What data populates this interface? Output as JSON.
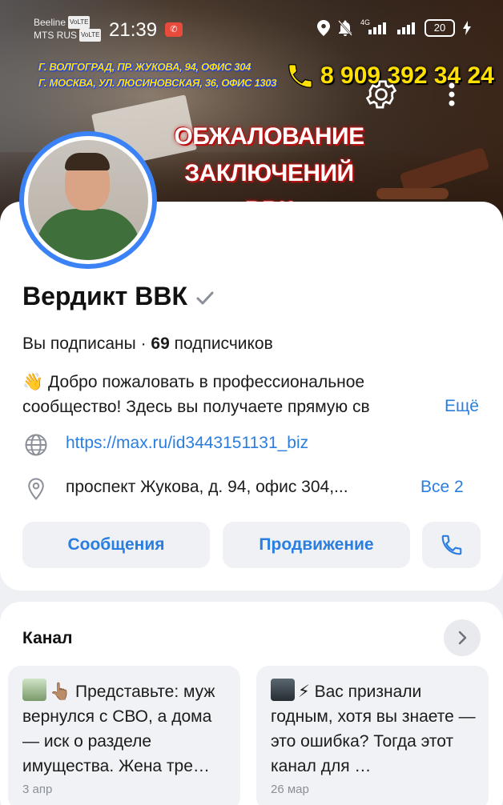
{
  "status_bar": {
    "carrier1": "Beeline",
    "carrier2": "MTS RUS",
    "volte": "VoLTE",
    "time": "21:39",
    "network": "4G",
    "battery": "20"
  },
  "cover": {
    "address_line1": "Г. ВОЛГОГРАД, ПР. ЖУКОВА, 94, ОФИС 304",
    "address_line2": "Г. МОСКВА, УЛ. ЛЮСИНОВСКАЯ, 36, ОФИС 1303",
    "phone": "8 909 392 34 24",
    "title_line1": "ОБЖАЛОВАНИЕ",
    "title_line2": "ЗАКЛЮЧЕНИЙ ВВК",
    "title_color": "#c01010",
    "accent_yellow": "#ffe000"
  },
  "profile": {
    "name": "Вердикт ВВК",
    "subscribed_prefix": "Вы подписаны · ",
    "subscribers_count": "69",
    "subscribers_suffix": " подписчиков",
    "description": "👋 Добро пожаловать в профессиональное сообщество! Здесь вы получаете прямую св",
    "more_label": "Ещё",
    "link": "https://max.ru/id3443151131_biz",
    "address": "проспект Жукова, д. 94, офис 304,...",
    "all_addresses_label": "Все 2",
    "accent": "#2a7ee0"
  },
  "buttons": {
    "messages": "Сообщения",
    "promotion": "Продвижение"
  },
  "channel": {
    "title": "Канал",
    "posts": [
      {
        "emoji": "👆🏽",
        "text": "Представьте: муж вернулся с СВО, а дома — иск о разделе имущества. Жена тре…",
        "date": "3 апр"
      },
      {
        "emoji": "⚡",
        "text": "Вас признали годным, хотя вы знаете — это ошибка? Тогда этот канал для …",
        "date": "26 мар"
      }
    ]
  }
}
